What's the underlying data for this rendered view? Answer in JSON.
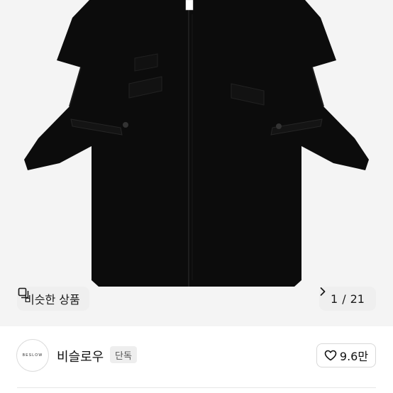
{
  "gallery": {
    "similar_button": {
      "label": "비슷한 상품",
      "icon": "similar-products-icon"
    },
    "page_counter": {
      "current": "1",
      "separator": "/",
      "total": "21",
      "icon": "chevron-right-icon"
    }
  },
  "store": {
    "logo_text": "BESLOW",
    "name": "비슬로우",
    "badge": "단독",
    "likes": "9.6만",
    "like_icon": "heart-icon"
  },
  "colors": {
    "background": "#f4f4f4",
    "coat": "#0c0c0c"
  }
}
